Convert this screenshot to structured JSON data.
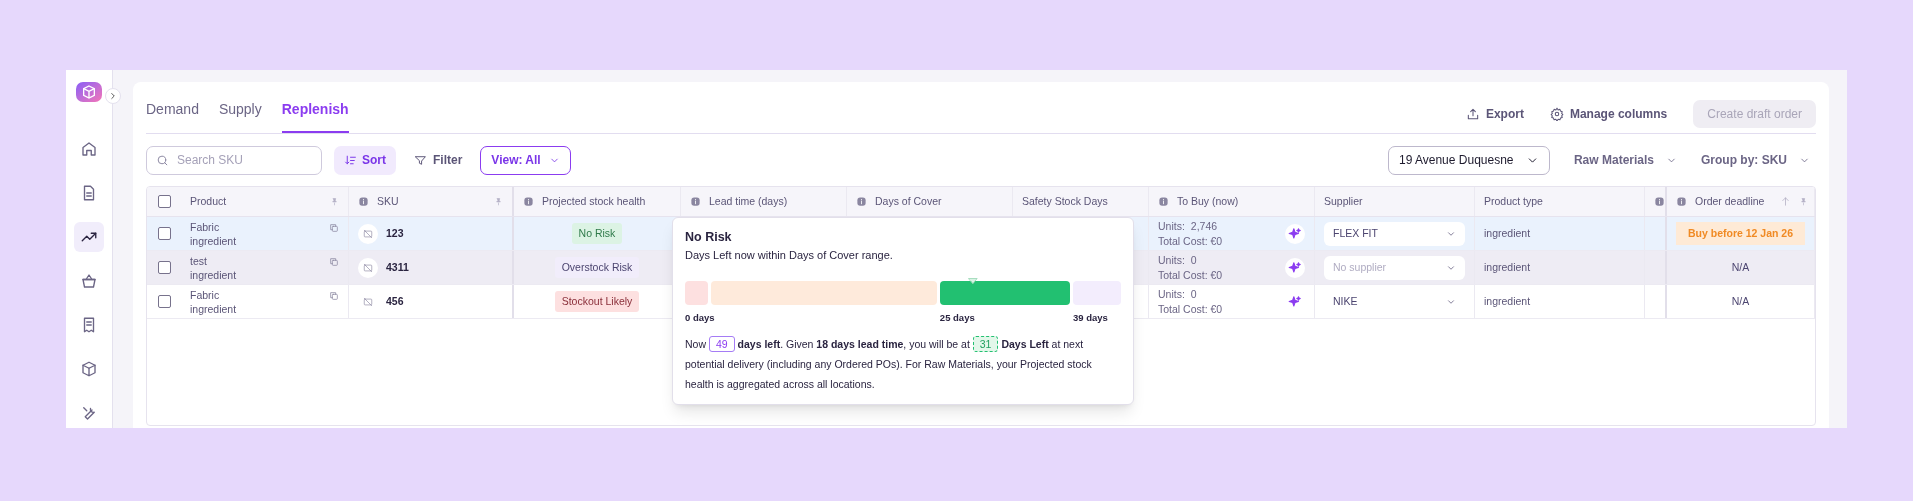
{
  "sidebar": {
    "items": [
      {
        "kind": "home",
        "selected": false
      },
      {
        "kind": "document",
        "selected": false
      },
      {
        "kind": "trend",
        "selected": true
      },
      {
        "kind": "basket",
        "selected": false
      },
      {
        "kind": "receipt",
        "selected": false
      },
      {
        "kind": "boxes",
        "selected": false
      },
      {
        "kind": "tools",
        "selected": false
      }
    ]
  },
  "tabs": [
    {
      "label": "Demand",
      "selected": false
    },
    {
      "label": "Supply",
      "selected": false
    },
    {
      "label": "Replenish",
      "selected": true
    }
  ],
  "actions": {
    "export": "Export",
    "manage_columns": "Manage columns",
    "create": {
      "label": "Create draft order",
      "disabled": true
    }
  },
  "toolbar": {
    "search": {
      "placeholder": "Search SKU"
    },
    "sort": "Sort",
    "filter": "Filter",
    "view": "View: All",
    "location": "19 Avenue Duquesne",
    "category": "Raw Materials",
    "group_by": "Group by: SKU"
  },
  "table": {
    "select_all_checked": false,
    "columns": [
      {
        "label": "Product",
        "info": false,
        "pinned": true
      },
      {
        "label": "SKU",
        "info": true,
        "pinned": true
      },
      {
        "label": "Projected stock health",
        "info": true,
        "pinned": false
      },
      {
        "label": "Lead time (days)",
        "info": true,
        "pinned": false
      },
      {
        "label": "Days of Cover",
        "info": true,
        "pinned": false
      },
      {
        "label": "Safety Stock Days",
        "info": false,
        "pinned": false
      },
      {
        "label": "To Buy (now)",
        "info": true,
        "pinned": false
      },
      {
        "label": "Supplier",
        "info": false,
        "pinned": false
      },
      {
        "label": "Product type",
        "info": false,
        "pinned": false
      },
      {
        "info": true,
        "pinned": false
      },
      {
        "label": "Order deadline",
        "info": true,
        "pinned": true,
        "sorted": true
      }
    ],
    "rows": [
      {
        "selected": true,
        "hovered": false,
        "checked": false,
        "product": "Fabric",
        "product_kind": "ingredient",
        "sku": "123",
        "health": {
          "kind": "no_risk",
          "label": "No Risk"
        },
        "units_label": "Units:",
        "units": "2,746",
        "cost": "Total Cost: €0",
        "supplier": {
          "value": "FLEX FIT"
        },
        "product_type": "ingredient",
        "deadline": {
          "kind": "badge",
          "label": "Buy before 12 Jan 26"
        }
      },
      {
        "selected": false,
        "hovered": true,
        "checked": false,
        "product": "test",
        "product_kind": "ingredient",
        "sku": "4311",
        "health": {
          "kind": "overstock",
          "label": "Overstock Risk"
        },
        "units_label": "Units:",
        "units": "0",
        "cost": "Total Cost: €0",
        "supplier": {
          "placeholder": "No supplier"
        },
        "product_type": "ingredient",
        "deadline": {
          "kind": "text",
          "label": "N/A"
        }
      },
      {
        "selected": false,
        "hovered": false,
        "checked": false,
        "product": "Fabric",
        "product_kind": "ingredient",
        "sku": "456",
        "health": {
          "kind": "stockout",
          "label": "Stockout Likely"
        },
        "units_label": "Units:",
        "units": "0",
        "cost": "Total Cost: €0",
        "supplier": {
          "value": "NIKE"
        },
        "product_type": "ingredient",
        "deadline": {
          "kind": "text",
          "label": "N/A"
        }
      }
    ]
  },
  "popover": {
    "title": "No Risk",
    "subtitle": "Days Left now within Days of Cover range.",
    "segments": [
      {
        "kind": "stockout",
        "label": "0 days"
      },
      {
        "kind": "low"
      },
      {
        "kind": "ok",
        "label": "25 days"
      },
      {
        "kind": "over",
        "label": "39 days"
      }
    ],
    "marker": {
      "level": 0.66
    },
    "text_1": "Now",
    "days_now": "49",
    "text_2": "**days left**. Given **18 days lead time**, you will be at",
    "days_next": "31",
    "text_3": "**Days Left** at next potential delivery (including any Ordered POs). For Raw Materials, your Projected stock health is aggregated across all locations."
  }
}
